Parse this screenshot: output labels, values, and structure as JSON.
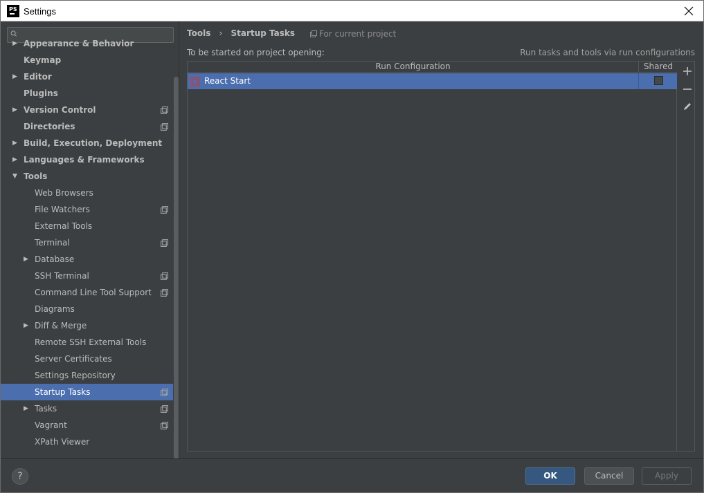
{
  "window": {
    "title": "Settings",
    "app_icon_text": "PS"
  },
  "sidebar": {
    "search_placeholder": "",
    "items": [
      {
        "label": "Appearance & Behavior",
        "level": 1,
        "bold": true,
        "arrow": "right",
        "project": false
      },
      {
        "label": "Keymap",
        "level": 1,
        "bold": true,
        "arrow": "",
        "project": false
      },
      {
        "label": "Editor",
        "level": 1,
        "bold": true,
        "arrow": "right",
        "project": false
      },
      {
        "label": "Plugins",
        "level": 1,
        "bold": true,
        "arrow": "",
        "project": false
      },
      {
        "label": "Version Control",
        "level": 1,
        "bold": true,
        "arrow": "right",
        "project": true
      },
      {
        "label": "Directories",
        "level": 1,
        "bold": true,
        "arrow": "",
        "project": true
      },
      {
        "label": "Build, Execution, Deployment",
        "level": 1,
        "bold": true,
        "arrow": "right",
        "project": false
      },
      {
        "label": "Languages & Frameworks",
        "level": 1,
        "bold": true,
        "arrow": "right",
        "project": false
      },
      {
        "label": "Tools",
        "level": 1,
        "bold": true,
        "arrow": "down",
        "project": false
      },
      {
        "label": "Web Browsers",
        "level": 2,
        "bold": false,
        "arrow": "",
        "project": false
      },
      {
        "label": "File Watchers",
        "level": 2,
        "bold": false,
        "arrow": "",
        "project": true
      },
      {
        "label": "External Tools",
        "level": 2,
        "bold": false,
        "arrow": "",
        "project": false
      },
      {
        "label": "Terminal",
        "level": 2,
        "bold": false,
        "arrow": "",
        "project": true
      },
      {
        "label": "Database",
        "level": 2,
        "bold": false,
        "arrow": "right",
        "project": false
      },
      {
        "label": "SSH Terminal",
        "level": 2,
        "bold": false,
        "arrow": "",
        "project": true
      },
      {
        "label": "Command Line Tool Support",
        "level": 2,
        "bold": false,
        "arrow": "",
        "project": true
      },
      {
        "label": "Diagrams",
        "level": 2,
        "bold": false,
        "arrow": "",
        "project": false
      },
      {
        "label": "Diff & Merge",
        "level": 2,
        "bold": false,
        "arrow": "right",
        "project": false
      },
      {
        "label": "Remote SSH External Tools",
        "level": 2,
        "bold": false,
        "arrow": "",
        "project": false
      },
      {
        "label": "Server Certificates",
        "level": 2,
        "bold": false,
        "arrow": "",
        "project": false
      },
      {
        "label": "Settings Repository",
        "level": 2,
        "bold": false,
        "arrow": "",
        "project": false
      },
      {
        "label": "Startup Tasks",
        "level": 2,
        "bold": false,
        "arrow": "",
        "project": true,
        "selected": true
      },
      {
        "label": "Tasks",
        "level": 2,
        "bold": false,
        "arrow": "right",
        "project": true
      },
      {
        "label": "Vagrant",
        "level": 2,
        "bold": false,
        "arrow": "",
        "project": true
      },
      {
        "label": "XPath Viewer",
        "level": 2,
        "bold": false,
        "arrow": "",
        "project": false
      }
    ]
  },
  "main": {
    "breadcrumb": [
      "Tools",
      "Startup Tasks"
    ],
    "breadcrumb_separator": "›",
    "scope": "For current project",
    "section_label": "To be started on project opening:",
    "hint": "Run tasks and tools via run configurations",
    "table": {
      "columns": [
        "Run Configuration",
        "Shared"
      ],
      "rows": [
        {
          "name": "React Start",
          "shared": false,
          "icon": "npm-icon"
        }
      ]
    },
    "toolbar": [
      "add-icon",
      "remove-icon",
      "edit-icon"
    ]
  },
  "footer": {
    "help_label": "?",
    "ok_label": "OK",
    "cancel_label": "Cancel",
    "apply_label": "Apply"
  },
  "colors": {
    "background": "#3c3f41",
    "selection": "#4b6eaf",
    "ok_button": "#365880",
    "text": "#bbbbbb",
    "npm_red": "#cb3837"
  }
}
